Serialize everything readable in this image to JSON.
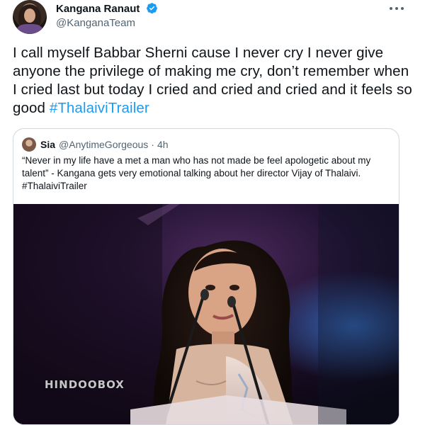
{
  "tweet": {
    "author": {
      "name": "Kangana Ranaut",
      "handle": "@KanganaTeam",
      "verified": true
    },
    "text_before": "I call myself Babbar Sherni cause I never cry I never give anyone the privilege of making me cry, don’t remember when I cried last but today I cried and cried and cried and it feels so good ",
    "hashtag": "#ThalaiviTrailer",
    "menu_icon": "more-dots-icon"
  },
  "quote": {
    "name": "Sia",
    "handle": "@AnytimeGorgeous",
    "separator": "·",
    "time": "4h",
    "text": "“Never in my life have a met a man who has not made be feel apologetic about my talent” - Kangana gets very emotional talking about her director Vijay of Thalaivi. #ThalaiviTrailer",
    "media": {
      "watermark": "HINDOOBOX"
    }
  },
  "colors": {
    "link": "#1d9bf0",
    "verified": "#1d9bf0",
    "secondary_text": "#536471",
    "border": "#cfd9de"
  }
}
